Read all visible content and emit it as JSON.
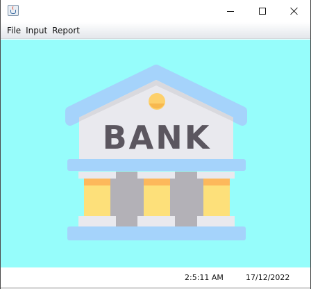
{
  "window": {
    "title": "",
    "controls": [
      "minimize",
      "maximize",
      "close"
    ]
  },
  "menu": {
    "items": [
      {
        "label": "File"
      },
      {
        "label": "Input"
      },
      {
        "label": "Report"
      }
    ]
  },
  "illustration": {
    "sign_text": "BANK",
    "icon": "bank-building-icon",
    "background_color": "#96fdfb"
  },
  "status": {
    "time": "2:5:11 AM",
    "date": "17/12/2022"
  }
}
